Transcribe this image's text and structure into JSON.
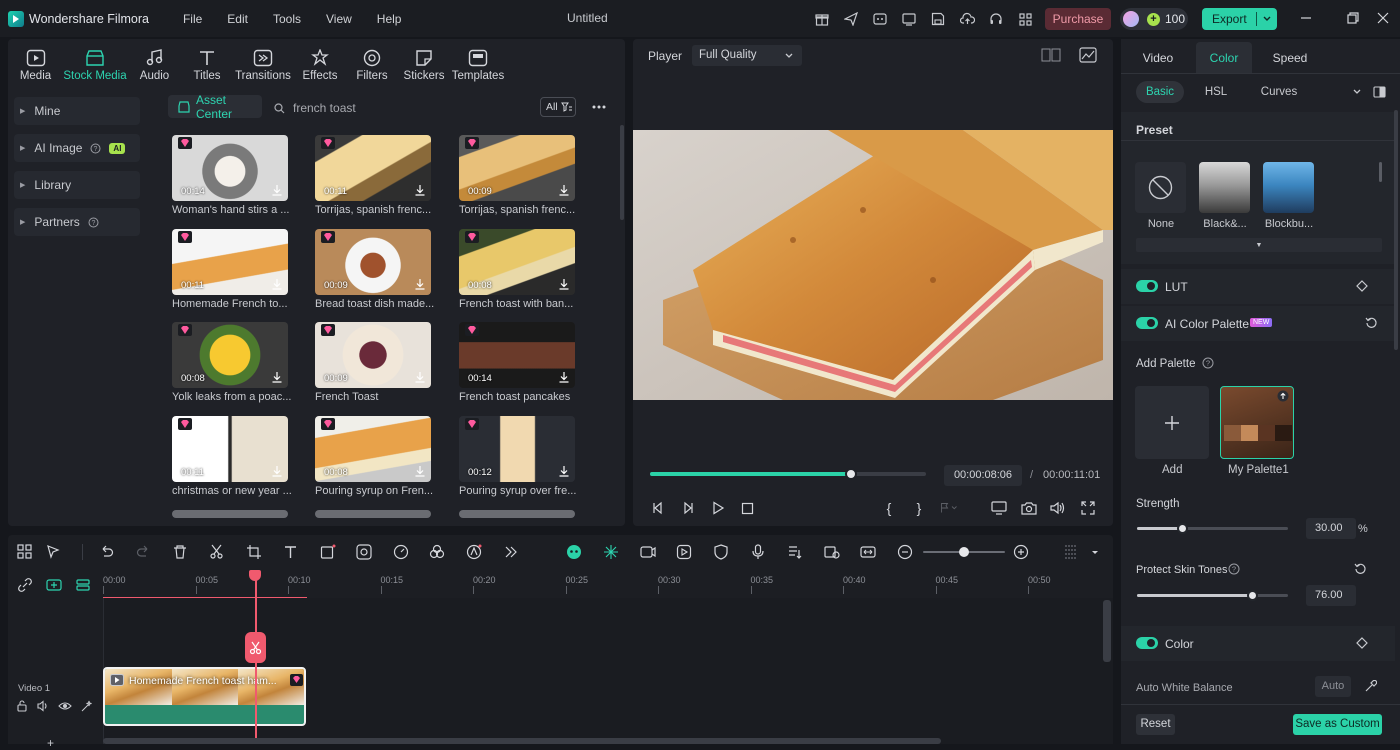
{
  "app": {
    "name": "Wondershare Filmora",
    "doc_title": "Untitled",
    "credits": "100",
    "purchase": "Purchase",
    "export": "Export"
  },
  "menu": [
    "File",
    "Edit",
    "Tools",
    "View",
    "Help"
  ],
  "media_tabs": [
    {
      "label": "Media",
      "icon": "media-icon"
    },
    {
      "label": "Stock Media",
      "icon": "stock-media-icon",
      "active": true
    },
    {
      "label": "Audio",
      "icon": "audio-icon"
    },
    {
      "label": "Titles",
      "icon": "titles-icon"
    },
    {
      "label": "Transitions",
      "icon": "transitions-icon"
    },
    {
      "label": "Effects",
      "icon": "effects-icon"
    },
    {
      "label": "Filters",
      "icon": "filters-icon"
    },
    {
      "label": "Stickers",
      "icon": "stickers-icon"
    },
    {
      "label": "Templates",
      "icon": "templates-icon"
    }
  ],
  "sidebar": {
    "items": [
      {
        "label": "Mine"
      },
      {
        "label": "AI Image",
        "badge": "AI"
      },
      {
        "label": "Library"
      },
      {
        "label": "Partners"
      }
    ]
  },
  "asset_center": {
    "tab": "Asset Center",
    "search": "french toast",
    "filter": "All"
  },
  "thumbnails": [
    {
      "dur": "00:14",
      "caption": "Woman's hand stirs a ..."
    },
    {
      "dur": "00:11",
      "caption": "Torrijas, spanish frenc..."
    },
    {
      "dur": "00:09",
      "caption": "Torrijas, spanish frenc..."
    },
    {
      "dur": "00:11",
      "caption": "Homemade French to..."
    },
    {
      "dur": "00:09",
      "caption": "Bread toast dish made..."
    },
    {
      "dur": "00:08",
      "caption": "French toast with ban..."
    },
    {
      "dur": "00:08",
      "caption": "Yolk leaks from a poac..."
    },
    {
      "dur": "00:09",
      "caption": "French Toast"
    },
    {
      "dur": "00:14",
      "caption": "French toast pancakes"
    },
    {
      "dur": "00:11",
      "caption": "christmas or new year ..."
    },
    {
      "dur": "00:08",
      "caption": "Pouring syrup on Fren..."
    },
    {
      "dur": "00:12",
      "caption": "Pouring syrup over fre..."
    }
  ],
  "player": {
    "label": "Player",
    "quality": "Full Quality",
    "current": "00:00:08:06",
    "sep": "/",
    "total": "00:00:11:01",
    "progress": 0.73
  },
  "right_panel": {
    "tabs": [
      "Video",
      "Color",
      "Speed"
    ],
    "active_tab": "Color",
    "subtabs": [
      "Basic",
      "HSL",
      "Curves"
    ],
    "preset_title": "Preset",
    "presets": [
      {
        "label": "None"
      },
      {
        "label": "Black&..."
      },
      {
        "label": "Blockbu..."
      }
    ],
    "lut": "LUT",
    "ai_color_palette": "AI Color Palette",
    "new_badge": "NEW",
    "add_palette": "Add Palette",
    "add_label": "Add",
    "my_palette": "My Palette1",
    "strength_label": "Strength",
    "strength_value": "30.00",
    "strength_unit": "%",
    "strength_level": 0.3,
    "protect_label": "Protect Skin Tones",
    "protect_value": "76.00",
    "protect_level": 0.76,
    "color_label": "Color",
    "awb_label": "Auto White Balance",
    "auto_label": "Auto",
    "reset": "Reset",
    "save_custom": "Save as Custom"
  },
  "timeline": {
    "ticks": [
      "00:00",
      "00:05",
      "00:10",
      "00:15",
      "00:20",
      "00:25",
      "00:30",
      "00:35",
      "00:40",
      "00:45",
      "00:50"
    ],
    "track_label": "Video 1",
    "clip_title": "Homemade French toast ham..."
  },
  "colors": {
    "accent": "#2bd2a8",
    "playhead": "#f05a6e",
    "purchase_bg": "#5a2b34"
  }
}
